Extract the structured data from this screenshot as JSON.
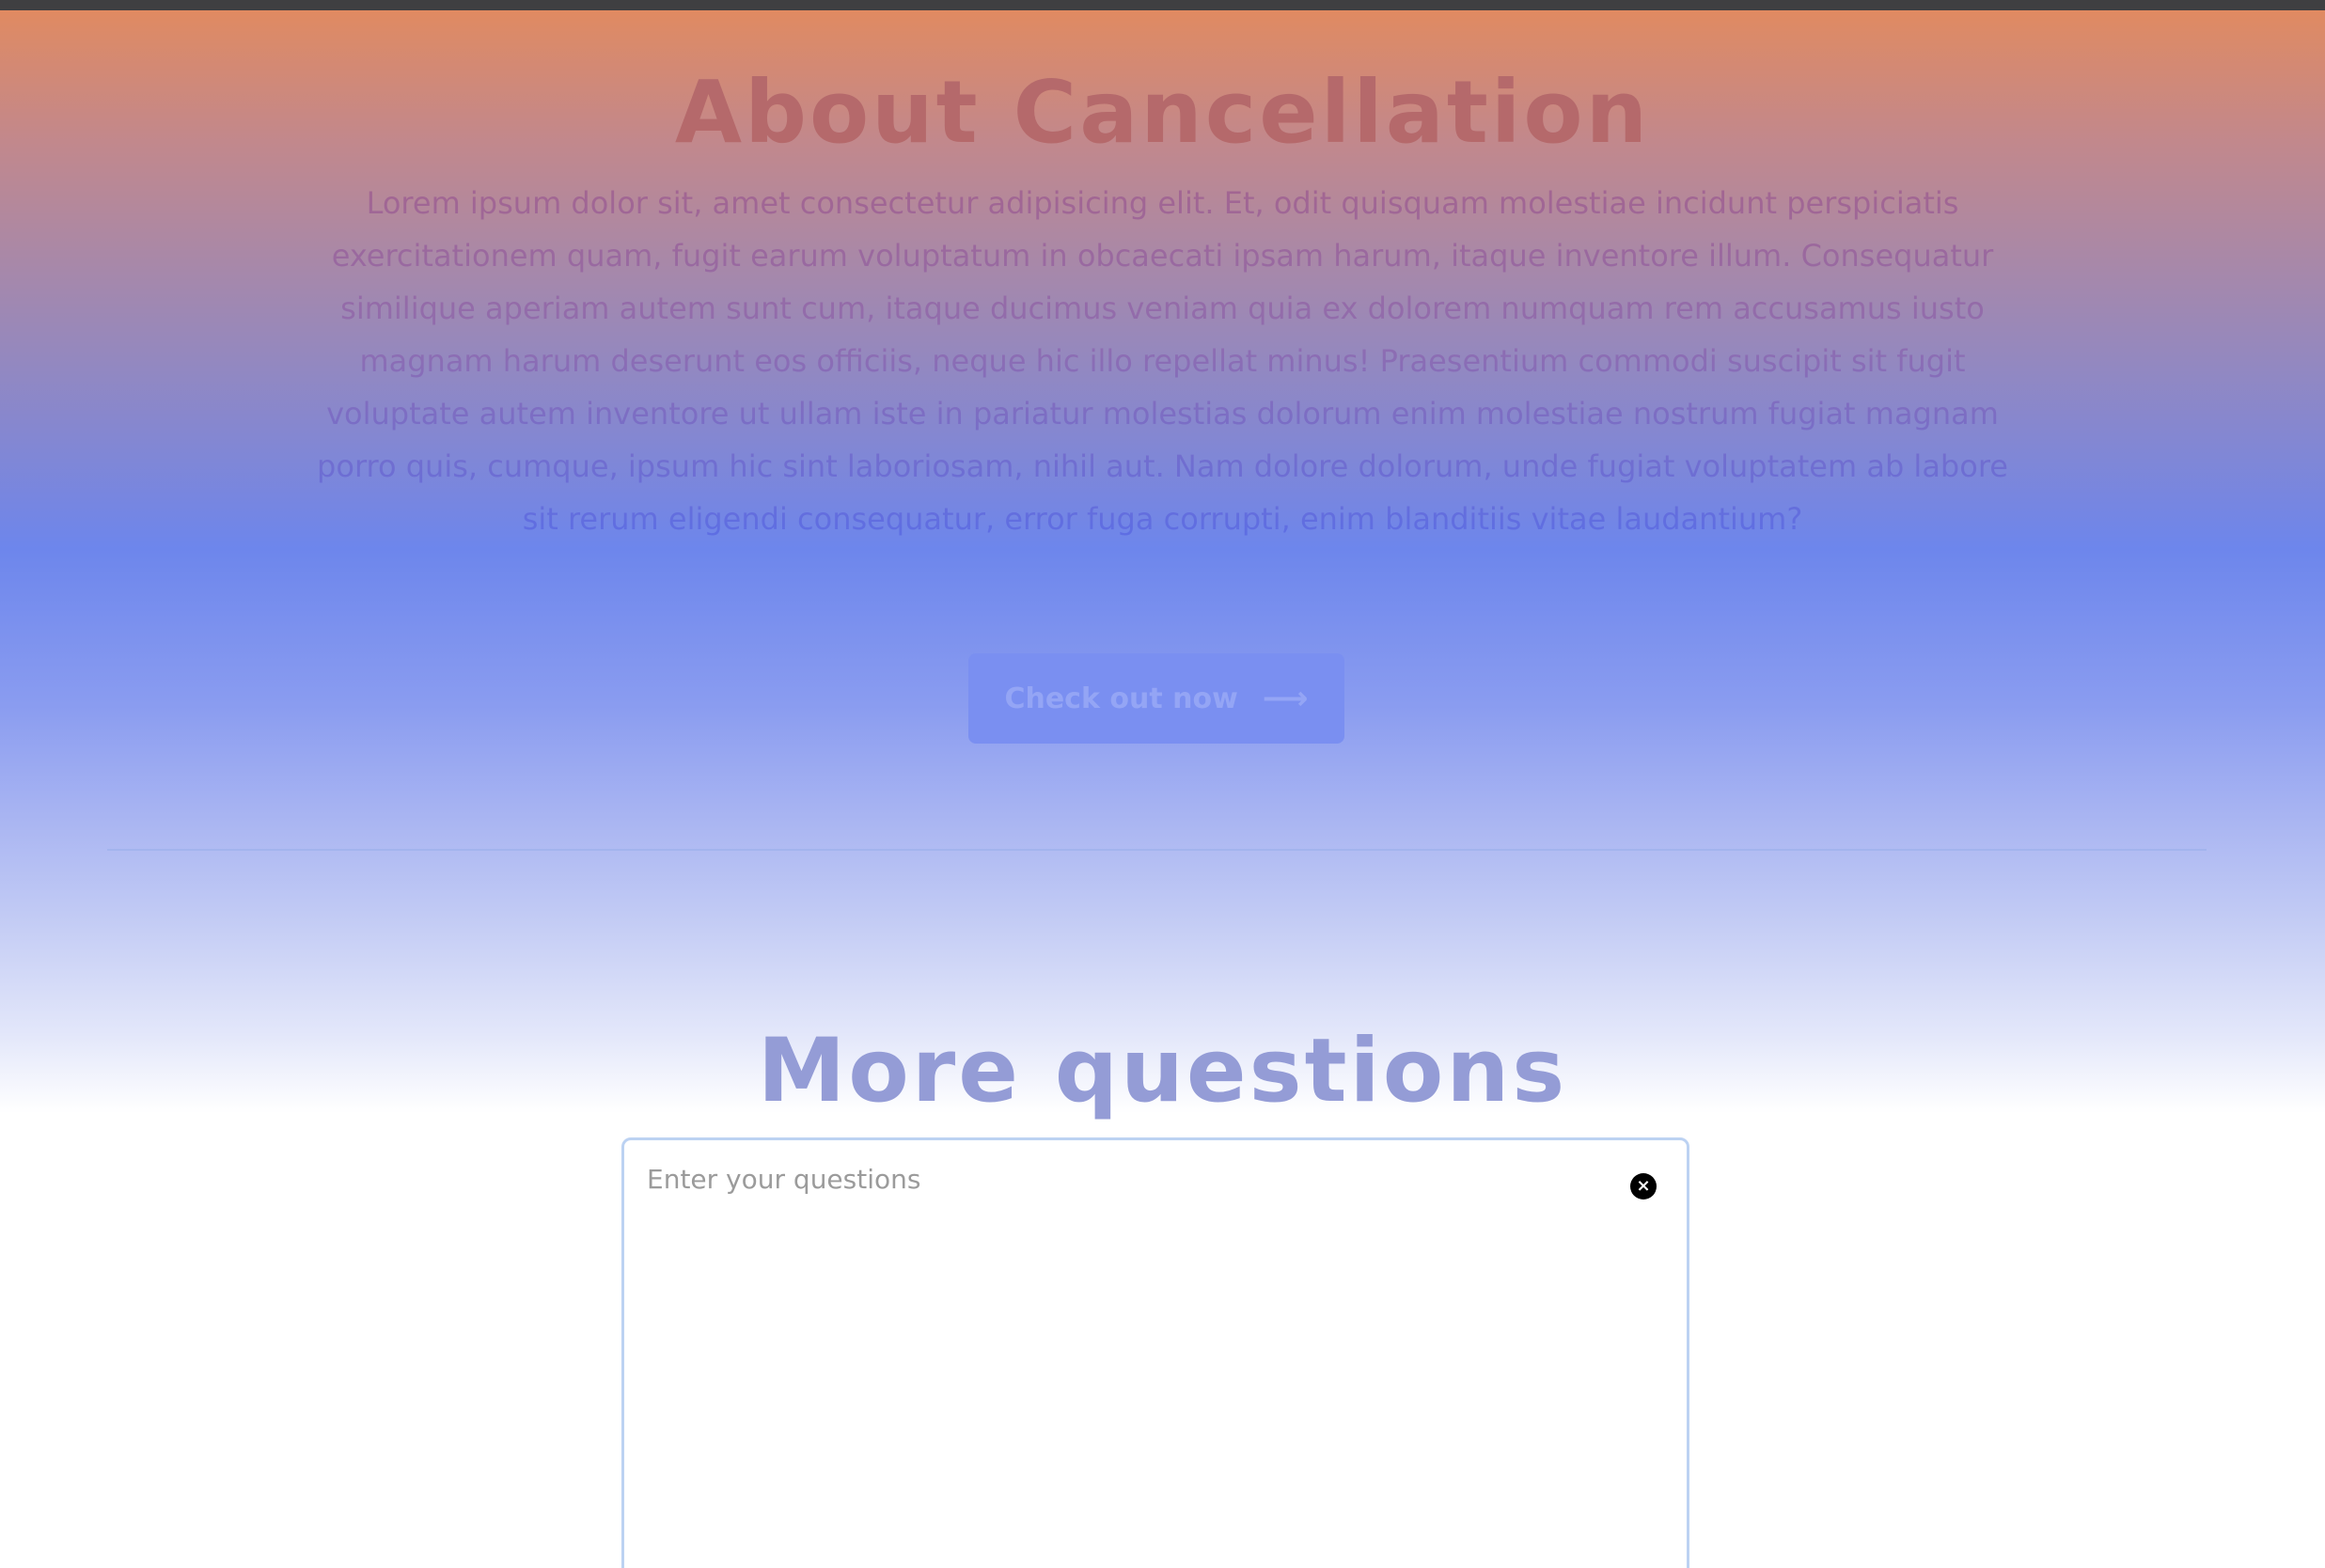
{
  "cancellation": {
    "title": "About Cancellation",
    "body": "Lorem ipsum dolor sit, amet consectetur adipisicing elit. Et, odit quisquam molestiae incidunt perspiciatis exercitationem quam, fugit earum voluptatum in obcaecati ipsam harum, itaque inventore illum. Consequatur similique aperiam autem sunt cum, itaque ducimus veniam quia ex dolorem numquam rem accusamus iusto magnam harum deserunt eos officiis, neque hic illo repellat minus! Praesentium commodi suscipit sit fugit voluptate autem inventore ut ullam iste in pariatur molestias dolorum enim molestiae nostrum fugiat magnam porro quis, cumque, ipsum hic sint laboriosam, nihil aut. Nam dolore dolorum, unde fugiat voluptatem ab labore sit rerum eligendi consequatur, error fuga corrupti, enim blanditiis vitae laudantium?",
    "checkout_button": {
      "label": "Check out now",
      "icon": "arrow-right-icon",
      "icon_glyph": "⟶"
    }
  },
  "questions": {
    "title": "More questions",
    "input": {
      "placeholder": "Enter your questions",
      "value": ""
    },
    "clear_button": {
      "icon": "close-circle-icon",
      "glyph": "×"
    }
  },
  "colors": {
    "top_bar": "#3f3f41",
    "gradient_top": "#e58c5c",
    "gradient_mid": "#6d86ec",
    "button_bg": "#7a8ff1",
    "questions_title": "#949cd6",
    "input_border": "#bcd2f2"
  }
}
